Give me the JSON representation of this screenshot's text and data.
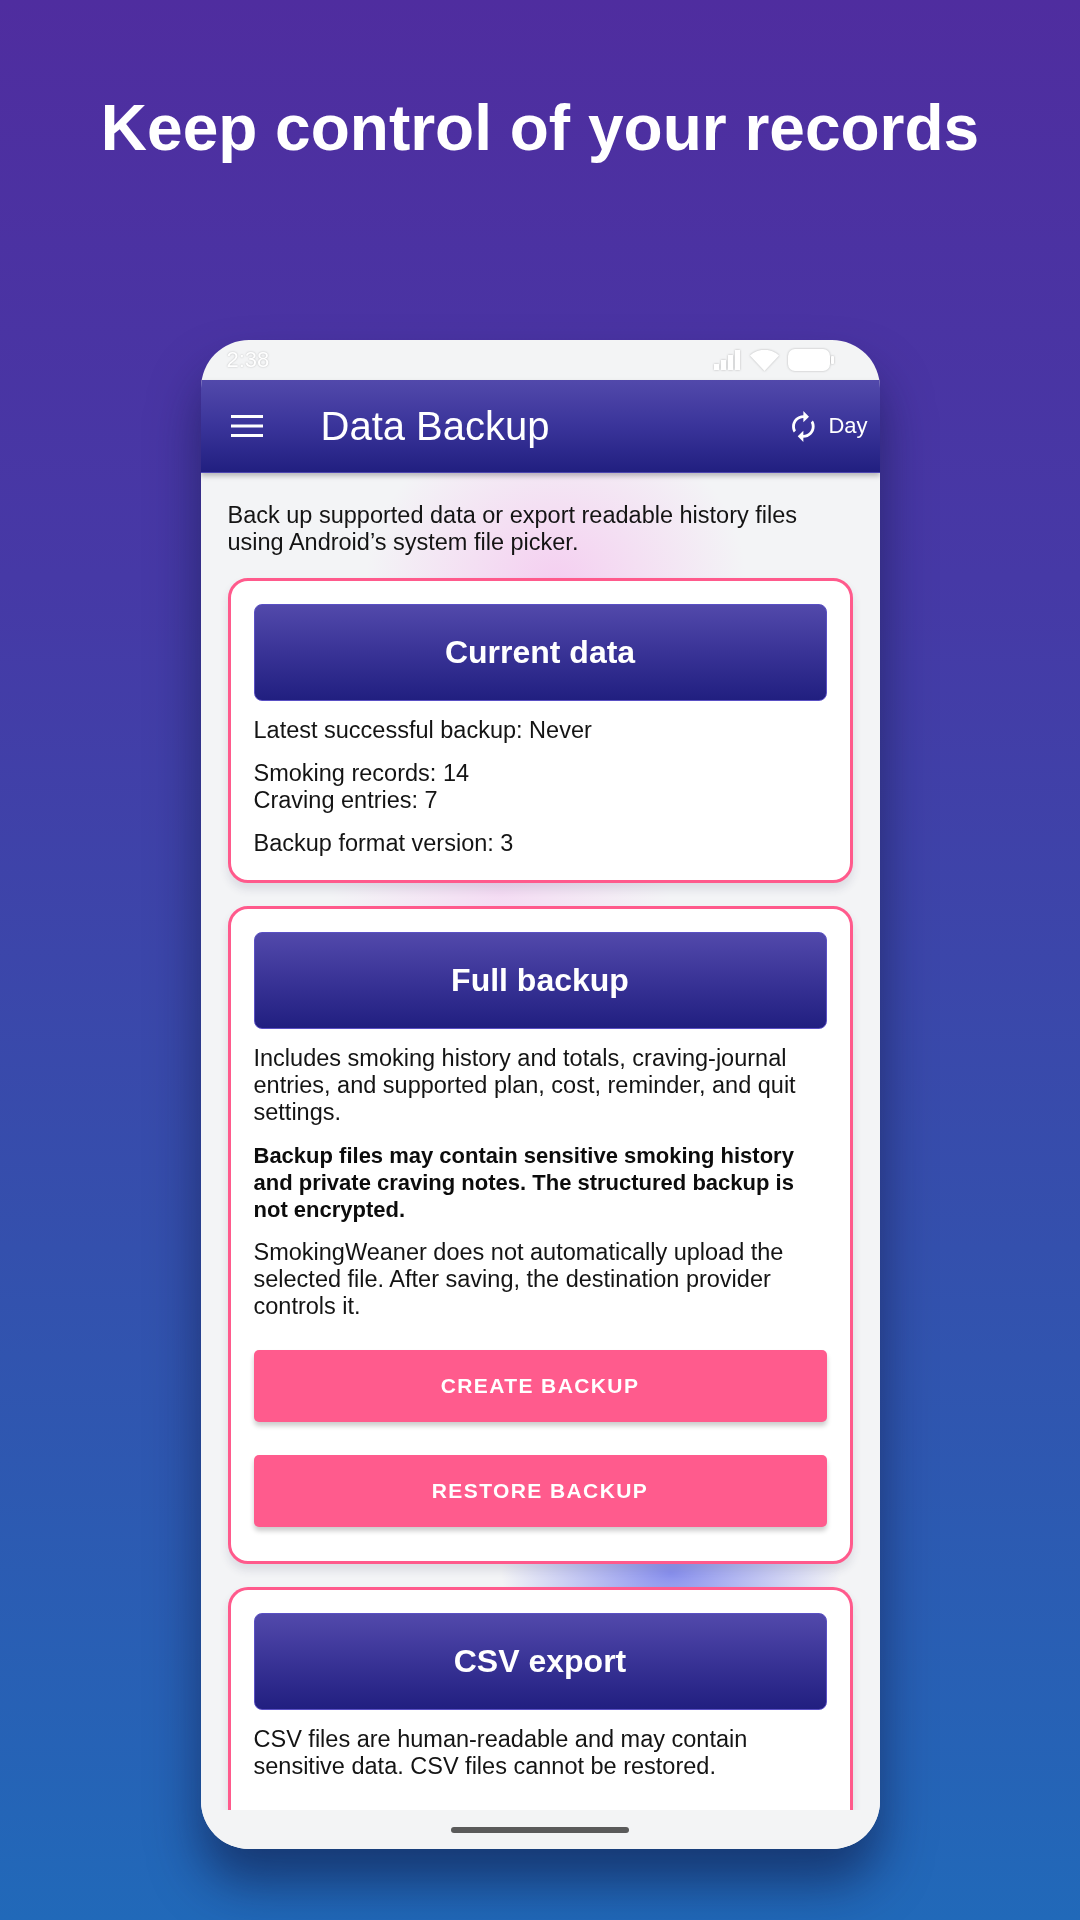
{
  "headline": "Keep control of your records",
  "status_bar": {
    "time": "2:38"
  },
  "app_bar": {
    "title": "Data Backup",
    "theme_toggle": {
      "label": "Day"
    }
  },
  "intro": "Back up supported data or export readable history files using Android’s system file picker.",
  "sections": [
    {
      "title": "Current data",
      "details": [
        {
          "lines": [
            "Latest successful backup: Never"
          ],
          "emphasis": false
        },
        {
          "lines": [
            "Smoking records: 14",
            "Craving entries: 7"
          ],
          "emphasis": false
        },
        {
          "lines": [
            "Backup format version: 3"
          ],
          "emphasis": false
        }
      ]
    },
    {
      "title": "Full backup",
      "details": [
        {
          "lines": [
            "Includes smoking history and totals, craving-journal entries, and supported plan, cost, reminder, and quit settings."
          ],
          "emphasis": false
        },
        {
          "lines": [
            "Backup files may contain sensitive smoking history and private craving notes. The structured backup is not encrypted."
          ],
          "emphasis": true
        },
        {
          "lines": [
            "SmokingWeaner does not automatically upload the selected file. After saving, the destination provider controls it."
          ],
          "emphasis": false
        }
      ],
      "buttons": [
        "CREATE BACKUP",
        "RESTORE BACKUP"
      ]
    },
    {
      "title": "CSV export",
      "details": [
        {
          "lines": [
            "CSV files are human-readable and may contain sensitive data. CSV files cannot be restored."
          ],
          "emphasis": false
        }
      ]
    }
  ]
}
